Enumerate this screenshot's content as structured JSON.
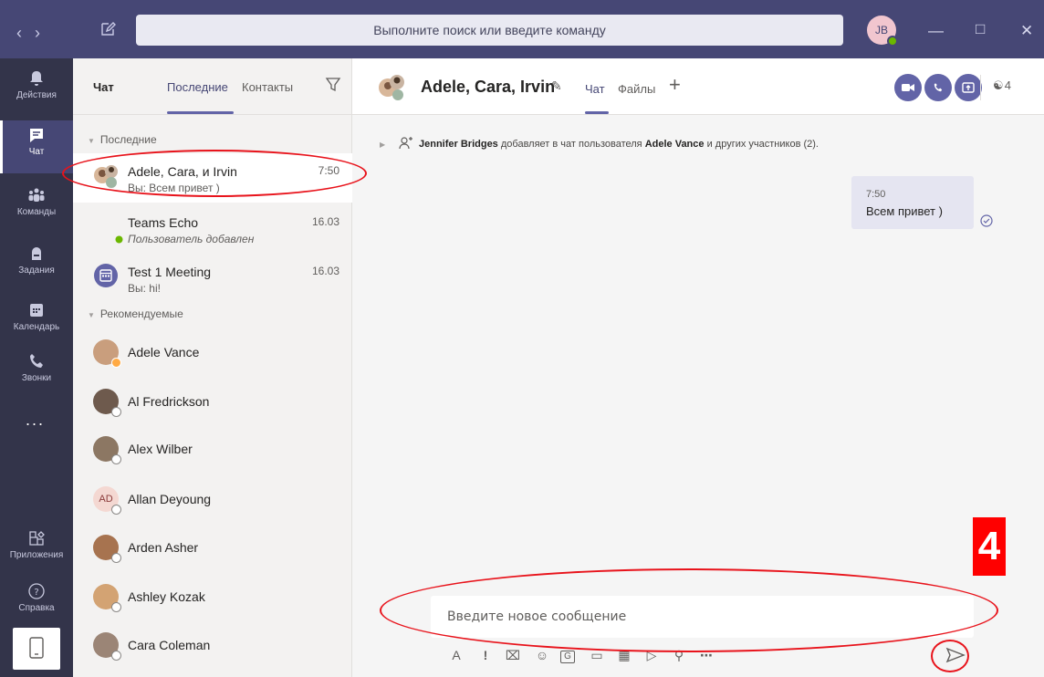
{
  "titlebar": {
    "search_placeholder": "Выполните поиск или введите команду",
    "user_initials": "JB"
  },
  "rail": {
    "items": [
      {
        "label": "Действия",
        "icon": "bell-icon"
      },
      {
        "label": "Чат",
        "icon": "chat-icon"
      },
      {
        "label": "Команды",
        "icon": "teams-icon"
      },
      {
        "label": "Задания",
        "icon": "assignments-icon"
      },
      {
        "label": "Календарь",
        "icon": "calendar-icon"
      },
      {
        "label": "Звонки",
        "icon": "phone-icon"
      },
      {
        "label": "Приложения",
        "icon": "apps-icon"
      },
      {
        "label": "Справка",
        "icon": "help-icon"
      }
    ],
    "more": "..."
  },
  "list": {
    "title": "Чат",
    "tab_recent": "Последние",
    "tab_contacts": "Контакты",
    "section_recent": "Последние",
    "section_suggested": "Рекомендуемые",
    "chats": [
      {
        "name": "Adele, Cara, и Irvin",
        "preview": "Вы: Всем привет )",
        "time": "7:50"
      },
      {
        "name": "Teams Echo",
        "preview": "Пользователь добавлен",
        "time": "16.03"
      },
      {
        "name": "Test 1 Meeting",
        "preview": "Вы: hi!",
        "time": "16.03"
      }
    ],
    "people": [
      {
        "name": "Adele Vance"
      },
      {
        "name": "Al Fredrickson"
      },
      {
        "name": "Alex Wilber"
      },
      {
        "name": "Allan Deyoung",
        "initials": "AD"
      },
      {
        "name": "Arden Asher"
      },
      {
        "name": "Ashley Kozak"
      },
      {
        "name": "Cara Coleman"
      }
    ]
  },
  "main": {
    "title": "Adele, Cara, Irvin",
    "tab_chat": "Чат",
    "tab_files": "Файлы",
    "participants_count": "4",
    "system_message": {
      "actor": "Jennifer Bridges",
      "text1": " добавляет в чат пользователя ",
      "target": "Adele Vance",
      "text2": " и других участников (2)."
    },
    "message": {
      "time": "7:50",
      "text": "Всем привет )"
    },
    "composer_placeholder": "Введите новое сообщение"
  },
  "annotation": {
    "step": "4"
  },
  "colors": {
    "brand": "#6264a7",
    "titlebar": "#464775",
    "rail": "#33344a",
    "annotation": "#e8131b"
  }
}
